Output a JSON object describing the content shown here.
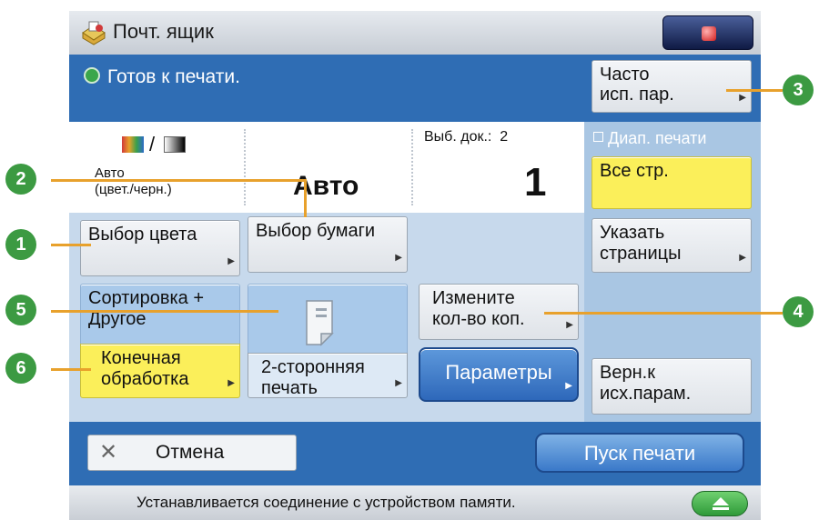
{
  "titlebar": {
    "title": "Почт. ящик"
  },
  "status": {
    "ready_text": "Готов к печати."
  },
  "info": {
    "color_mode": "Авто\n(цвет./черн.)",
    "paper_value": "Авто",
    "docs_label": "Выб. док.:",
    "docs_count": "2",
    "copies": "1"
  },
  "right": {
    "frequent_btn": "Часто\nисп. пар.",
    "range_label": "Диап. печати",
    "all_pages_btn": "Все стр.",
    "specify_pages_btn": "Указать\nстраницы",
    "reset_btn": "Верн.к\nисх.парам."
  },
  "buttons": {
    "color_select": "Выбор цвета",
    "paper_select": "Выбор бумаги",
    "sort_other": "Сортировка +\nДругое",
    "finishing": "Конечная\nобработка",
    "duplex": "2-сторонняя\nпечать",
    "change_copies": "Измените\nкол-во коп.",
    "parameters": "Параметры"
  },
  "bottom": {
    "cancel": "Отмена",
    "start": "Пуск печати"
  },
  "footer": {
    "message": "Устанавливается соединение с устройством памяти."
  },
  "callouts": [
    "1",
    "2",
    "3",
    "4",
    "5",
    "6"
  ],
  "colors": {
    "screen_blue": "#2f6db4",
    "callout_green": "#3c9a42",
    "callout_line": "#e8a12c",
    "highlight_yellow": "#fbef5a"
  }
}
